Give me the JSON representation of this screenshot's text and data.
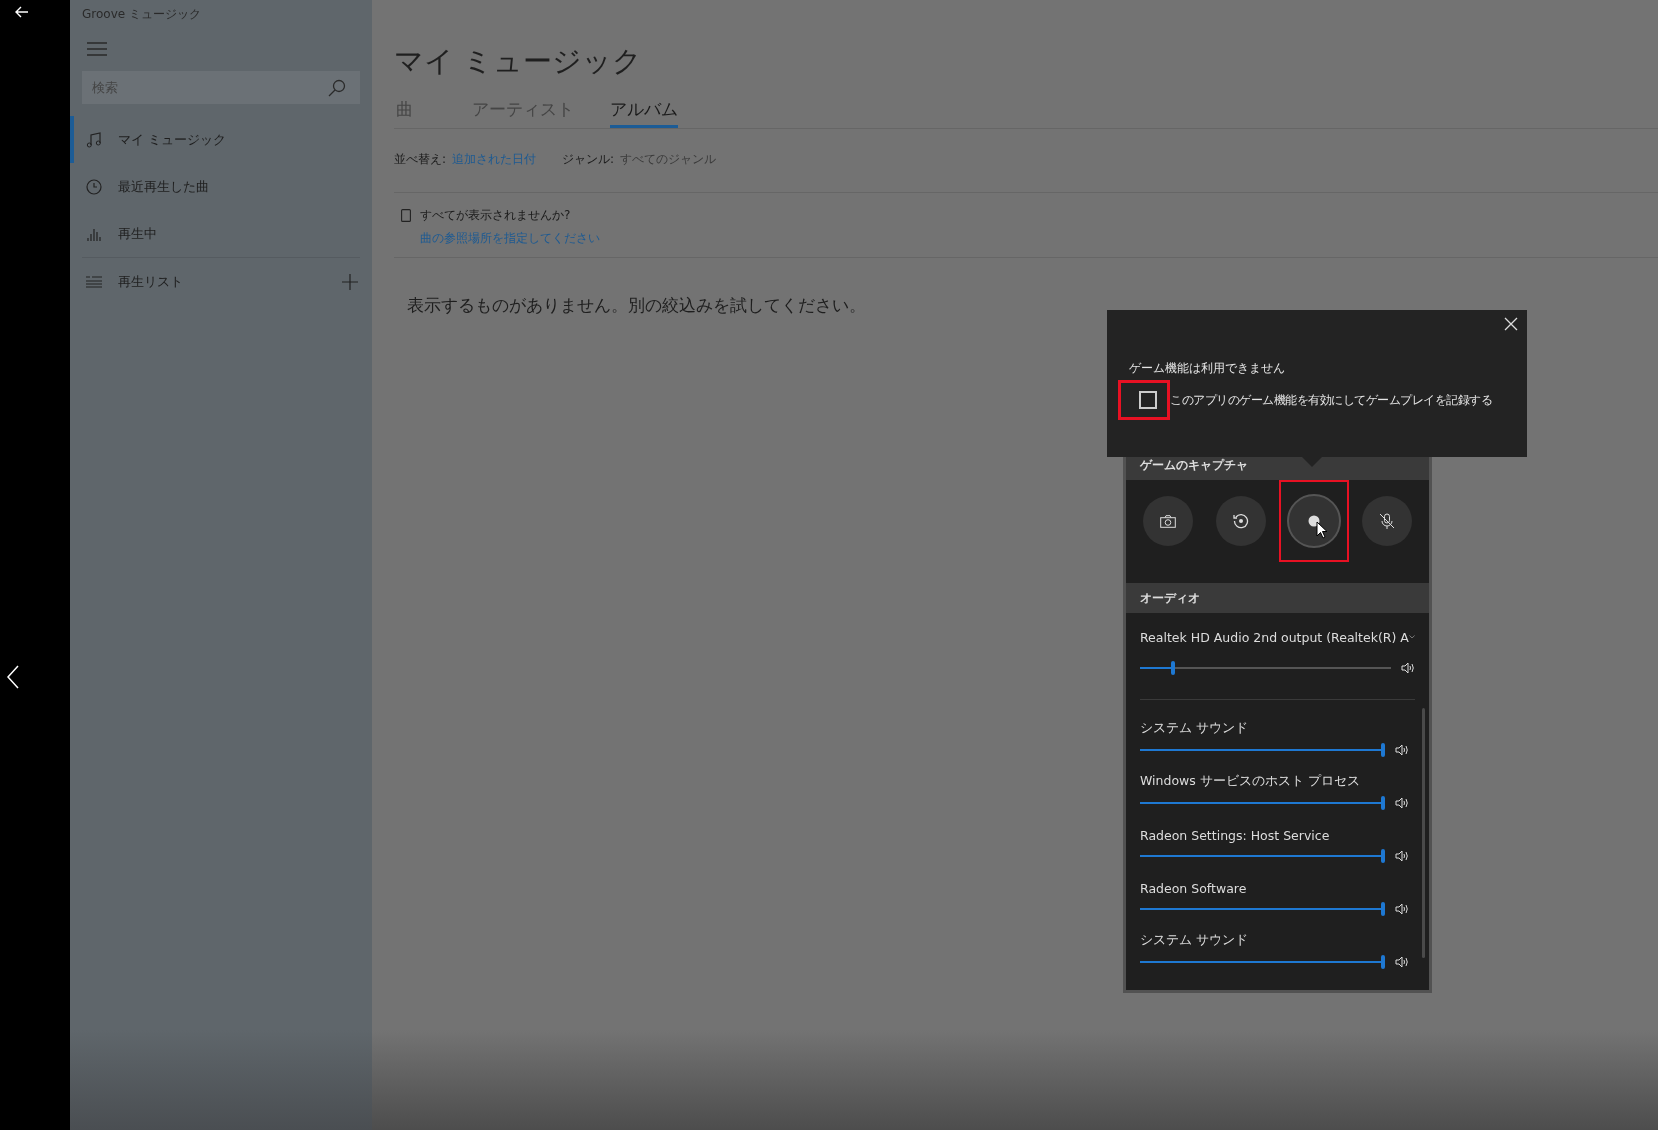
{
  "app_title": "Groove ミュージック",
  "search": {
    "placeholder": "検索"
  },
  "nav": [
    {
      "label": "マイ ミュージック",
      "selected": true
    },
    {
      "label": "最近再生した曲",
      "selected": false
    },
    {
      "label": "再生中",
      "selected": false
    }
  ],
  "playlists": {
    "label": "再生リスト"
  },
  "page_title": "マイ ミュージック",
  "tabs": [
    {
      "label": "曲",
      "selected": false
    },
    {
      "label": "アーティスト",
      "selected": false
    },
    {
      "label": "アルバム",
      "selected": true
    }
  ],
  "sort": {
    "label": "並べ替え:",
    "value": "追加された日付"
  },
  "genre": {
    "label": "ジャンル:",
    "value": "すべてのジャンル"
  },
  "notice": {
    "text": "すべてが表示されませんか?",
    "link": "曲の参照場所を指定してください"
  },
  "empty_message": "表示するものがありません。別の絞込みを試してください。",
  "popup": {
    "heading": "ゲーム機能は利用できません",
    "checkbox": {
      "label": "このアプリのゲーム機能を有効にしてゲームプレイを記録する",
      "checked": false,
      "highlighted": true
    }
  },
  "capture": {
    "title": "ゲームのキャプチャ",
    "buttons": [
      {
        "kind": "screenshot",
        "highlighted": false
      },
      {
        "kind": "replay",
        "highlighted": false
      },
      {
        "kind": "record",
        "highlighted": true
      },
      {
        "kind": "mic",
        "highlighted": false
      }
    ]
  },
  "audio": {
    "title": "オーディオ",
    "device": "Realtek HD Audio 2nd output (Realtek(R) A",
    "level": 0.14,
    "apps": [
      {
        "name": "システム サウンド",
        "level": 1
      },
      {
        "name": "Windows サービスのホスト プロセス",
        "level": 1
      },
      {
        "name": "Radeon Settings: Host Service",
        "level": 1
      },
      {
        "name": "Radeon Software",
        "level": 1
      },
      {
        "name": "システム サウンド",
        "level": 1
      }
    ]
  }
}
